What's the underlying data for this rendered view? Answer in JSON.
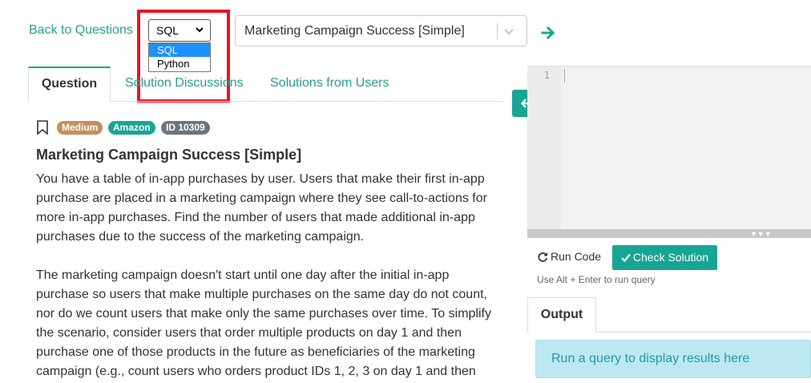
{
  "nav": {
    "back_label": "Back to Questions",
    "language_select": {
      "value": "SQL",
      "options": [
        {
          "label": "SQL",
          "selected": true
        },
        {
          "label": "Python",
          "selected": false
        }
      ]
    },
    "question_select": {
      "value": "Marketing Campaign Success [Simple]"
    }
  },
  "tabs": [
    {
      "label": "Question",
      "active": true
    },
    {
      "label": "Solution Discussions",
      "active": false
    },
    {
      "label": "Solutions from Users",
      "active": false
    }
  ],
  "question": {
    "badges": {
      "difficulty": "Medium",
      "company": "Amazon",
      "id": "ID 10309"
    },
    "title": "Marketing Campaign Success [Simple]",
    "paragraph_1": "You have a table of in-app purchases by user. Users that make their first in-app purchase are placed in a marketing campaign where they see call-to-actions for more in-app purchases. Find the number of users that made additional in-app purchases due to the success of the marketing campaign.",
    "paragraph_2": "The marketing campaign doesn't start until one day after the initial in-app purchase so users that make multiple purchases on the same day do not count, nor do we count users that make only the same purchases over time. To simplify the scenario, consider users that order multiple products on day 1 and then purchase one of those products in the future as beneficiaries of the marketing campaign (e.g., count users who orders product IDs 1, 2, 3 on day 1 and then"
  },
  "editor": {
    "line_number": "1"
  },
  "actions": {
    "run_label": "Run Code",
    "check_label": "Check Solution",
    "hint": "Use Alt + Enter to run query"
  },
  "output": {
    "tab_label": "Output",
    "message": "Run a query to display results here"
  },
  "colors": {
    "accent": "#18a595",
    "link": "#27a08f",
    "highlight_box": "#e8151e",
    "badge_medium": "#c58f5b",
    "badge_amazon": "#18a595",
    "badge_id": "#6c757d",
    "output_bg": "#bde8ef"
  },
  "icons": {
    "language_caret": "chevron-down-icon",
    "question_chevron": "chevron-down-icon",
    "go": "arrow-right-icon",
    "bookmark": "bookmark-icon",
    "collapse": "arrow-left-icon",
    "run": "refresh-icon",
    "check": "check-icon"
  }
}
